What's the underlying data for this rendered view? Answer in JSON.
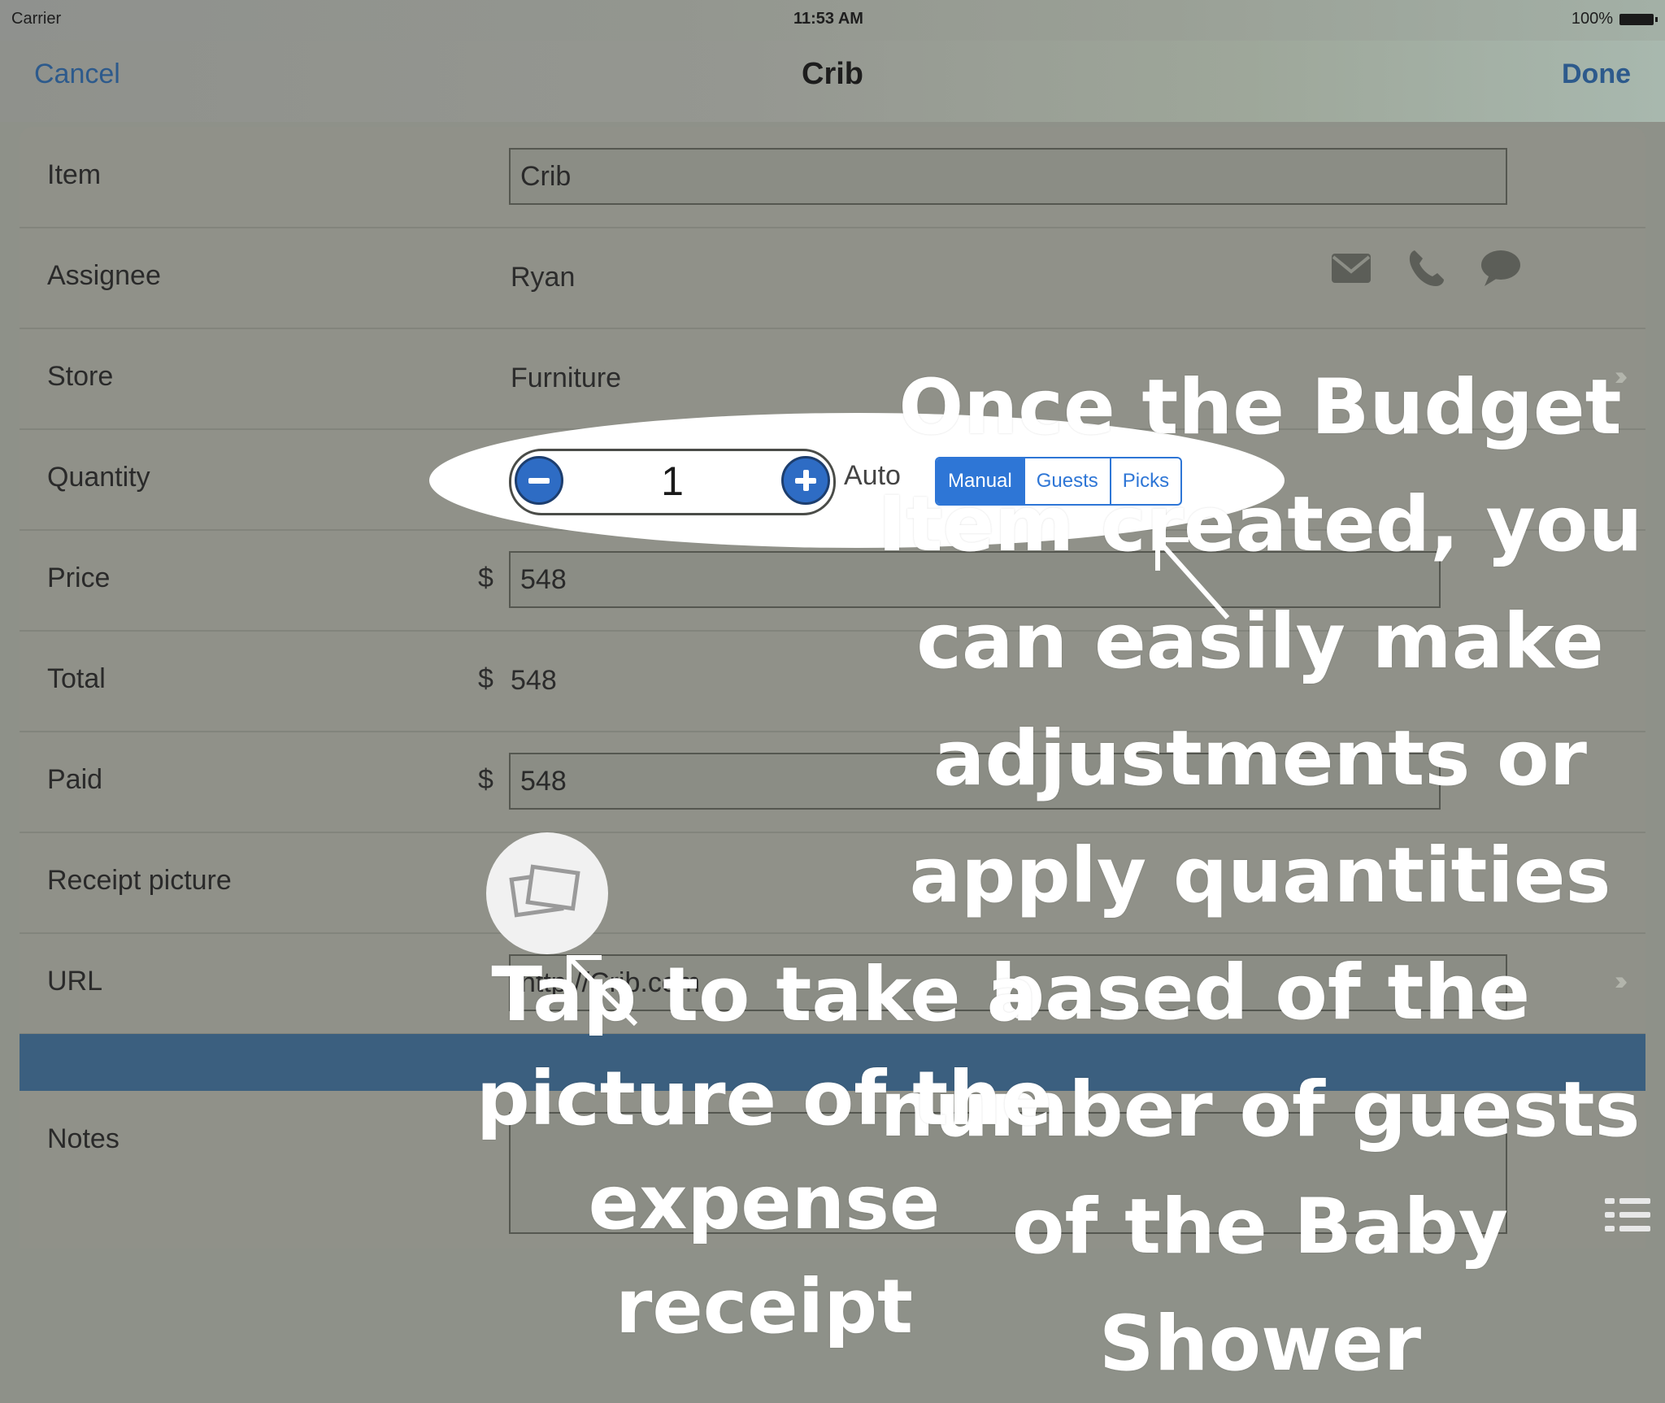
{
  "status_bar": {
    "carrier": "Carrier",
    "time": "11:53 AM",
    "battery": "100%"
  },
  "nav": {
    "cancel": "Cancel",
    "title": "Crib",
    "done": "Done"
  },
  "form": {
    "item": {
      "label": "Item",
      "value": "Crib"
    },
    "assignee": {
      "label": "Assignee",
      "value": "Ryan",
      "icons": [
        "mail-icon",
        "phone-icon",
        "chat-icon"
      ]
    },
    "store": {
      "label": "Store",
      "value": "Furniture"
    },
    "quantity": {
      "label": "Quantity",
      "value": "1",
      "auto_label": "Auto",
      "segments": [
        "Manual",
        "Guests",
        "Picks"
      ],
      "selected": "Manual"
    },
    "price": {
      "label": "Price",
      "currency": "$",
      "value": "548"
    },
    "total": {
      "label": "Total",
      "currency": "$",
      "value": "548"
    },
    "paid": {
      "label": "Paid",
      "currency": "$",
      "value": "548"
    },
    "receipt": {
      "label": "Receipt picture"
    },
    "url": {
      "label": "URL",
      "value": "http://Crib.com"
    },
    "notes": {
      "label": "Notes"
    }
  },
  "overlay": {
    "budget_text": "Once the Budget Item created, you can easily make adjustments or apply quantities based of the number of guests of the Baby Shower",
    "receipt_text": "Tap to take a picture of the expense receipt"
  },
  "colors": {
    "accent": "#2e76d6",
    "nav_link": "#2d5a8c",
    "band": "#3b5f7f"
  }
}
